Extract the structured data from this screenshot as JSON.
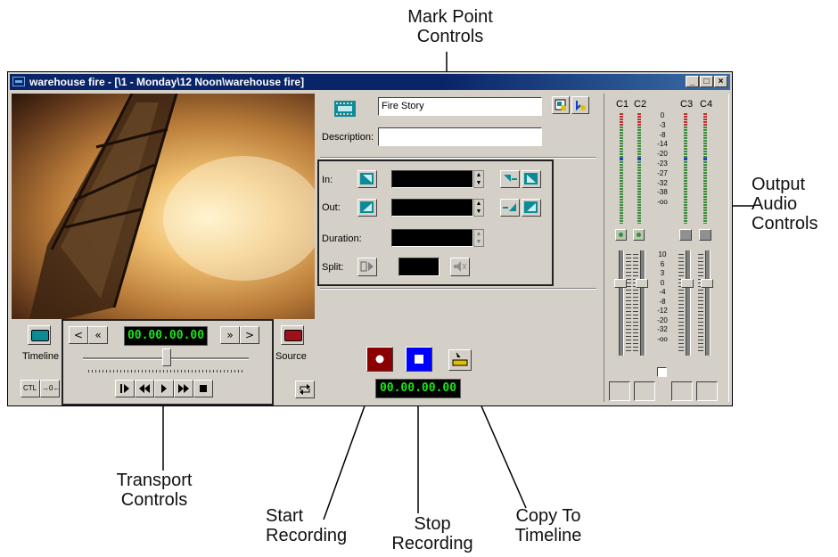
{
  "callouts": {
    "mark_point": "Mark Point\nControls",
    "output_audio": "Output\nAudio\nControls",
    "transport": "Transport\nControls",
    "start_recording": "Start\nRecording",
    "stop_recording": "Stop\nRecording",
    "copy_to_timeline": "Copy To\nTimeline"
  },
  "window": {
    "title": "warehouse fire - [\\1 - Monday\\12 Noon\\warehouse fire]",
    "minimize": "_",
    "maximize": "□",
    "close": "×"
  },
  "clip": {
    "name_value": "Fire Story",
    "description_label": "Description:",
    "description_value": ""
  },
  "mark_points": {
    "in_label": "In:",
    "out_label": "Out:",
    "duration_label": "Duration:",
    "split_label": "Split:"
  },
  "transport": {
    "timeline_label": "Timeline",
    "source_label": "Source",
    "timecode": "00.00.00.00",
    "prev": "<",
    "rewind_fast": "«",
    "forward_fast": "»",
    "next": ">",
    "ctl_label": "CTL",
    "marker_label": "→0←"
  },
  "record": {
    "timecode": "00.00.00.00"
  },
  "audio": {
    "channels": [
      "C1",
      "C2",
      "C3",
      "C4"
    ],
    "meter_scale": [
      "0",
      "-3",
      "-8",
      "-14",
      "-20",
      "-23",
      "-27",
      "-32",
      "-38",
      "-oo"
    ],
    "fader_scale": [
      "10",
      "6",
      "3",
      "0",
      "-4",
      "-8",
      "-12",
      "-20",
      "-32",
      "-oo"
    ]
  },
  "colors": {
    "title_bar": "#0a246a",
    "teal_button": "#0b8b96",
    "record_red": "#8b0000",
    "stop_blue": "#0000ff",
    "lcd_green": "#19e619"
  }
}
